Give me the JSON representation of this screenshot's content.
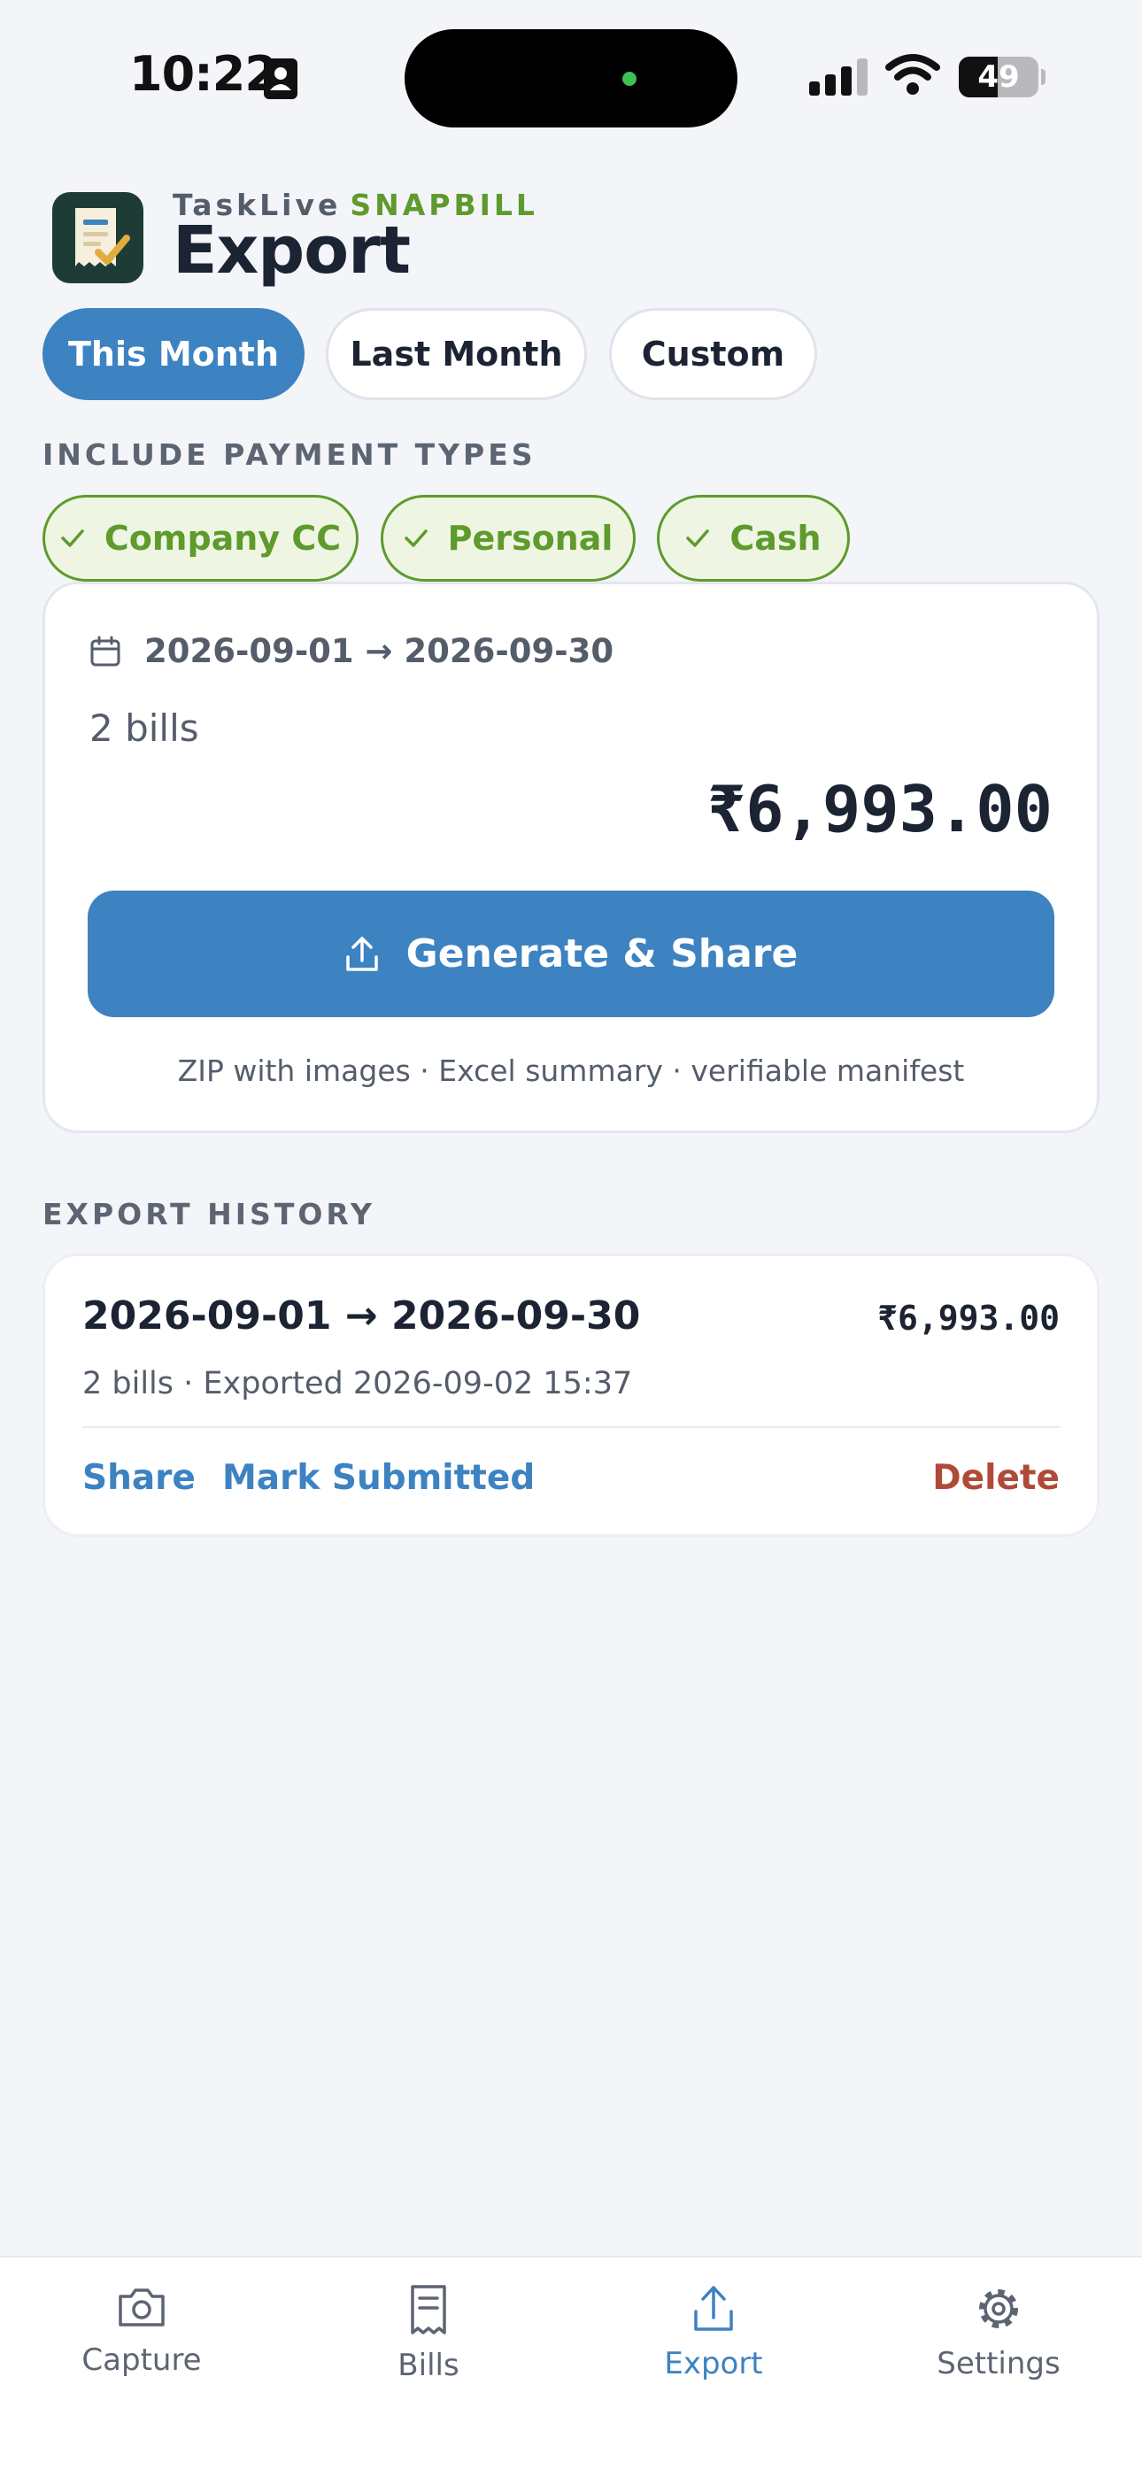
{
  "status_bar": {
    "time": "10:22",
    "battery": "49",
    "battery_level": 0.49
  },
  "header": {
    "brand": "TaskLive",
    "brand_accent": "SNAPBILL",
    "title": "Export"
  },
  "range_tabs": [
    {
      "label": "This Month",
      "active": true
    },
    {
      "label": "Last Month",
      "active": false
    },
    {
      "label": "Custom",
      "active": false
    }
  ],
  "payment_types": {
    "section_label": "INCLUDE PAYMENT TYPES",
    "chips": [
      {
        "label": "Company CC",
        "checked": true
      },
      {
        "label": "Personal",
        "checked": true
      },
      {
        "label": "Cash",
        "checked": true
      }
    ]
  },
  "summary": {
    "date_range": "2026-09-01 → 2026-09-30",
    "bill_count": "2 bills",
    "total": "₹6,993.00",
    "button_label": "Generate & Share",
    "footnote": "ZIP with images · Excel summary · verifiable manifest"
  },
  "history": {
    "section_label": "EXPORT HISTORY",
    "entries": [
      {
        "date_range": "2026-09-01 → 2026-09-30",
        "amount": "₹6,993.00",
        "meta": "2 bills · Exported 2026-09-02 15:37",
        "share_label": "Share",
        "mark_label": "Mark Submitted",
        "delete_label": "Delete"
      }
    ]
  },
  "nav": [
    {
      "label": "Capture",
      "icon": "camera-icon",
      "active": false
    },
    {
      "label": "Bills",
      "icon": "receipt-icon",
      "active": false
    },
    {
      "label": "Export",
      "icon": "upload-icon",
      "active": true
    },
    {
      "label": "Settings",
      "icon": "gear-icon",
      "active": false
    }
  ],
  "colors": {
    "primary": "#3d82c1",
    "accent_green": "#5e9a2c",
    "danger": "#b04a38",
    "background": "#f3f5f9"
  }
}
